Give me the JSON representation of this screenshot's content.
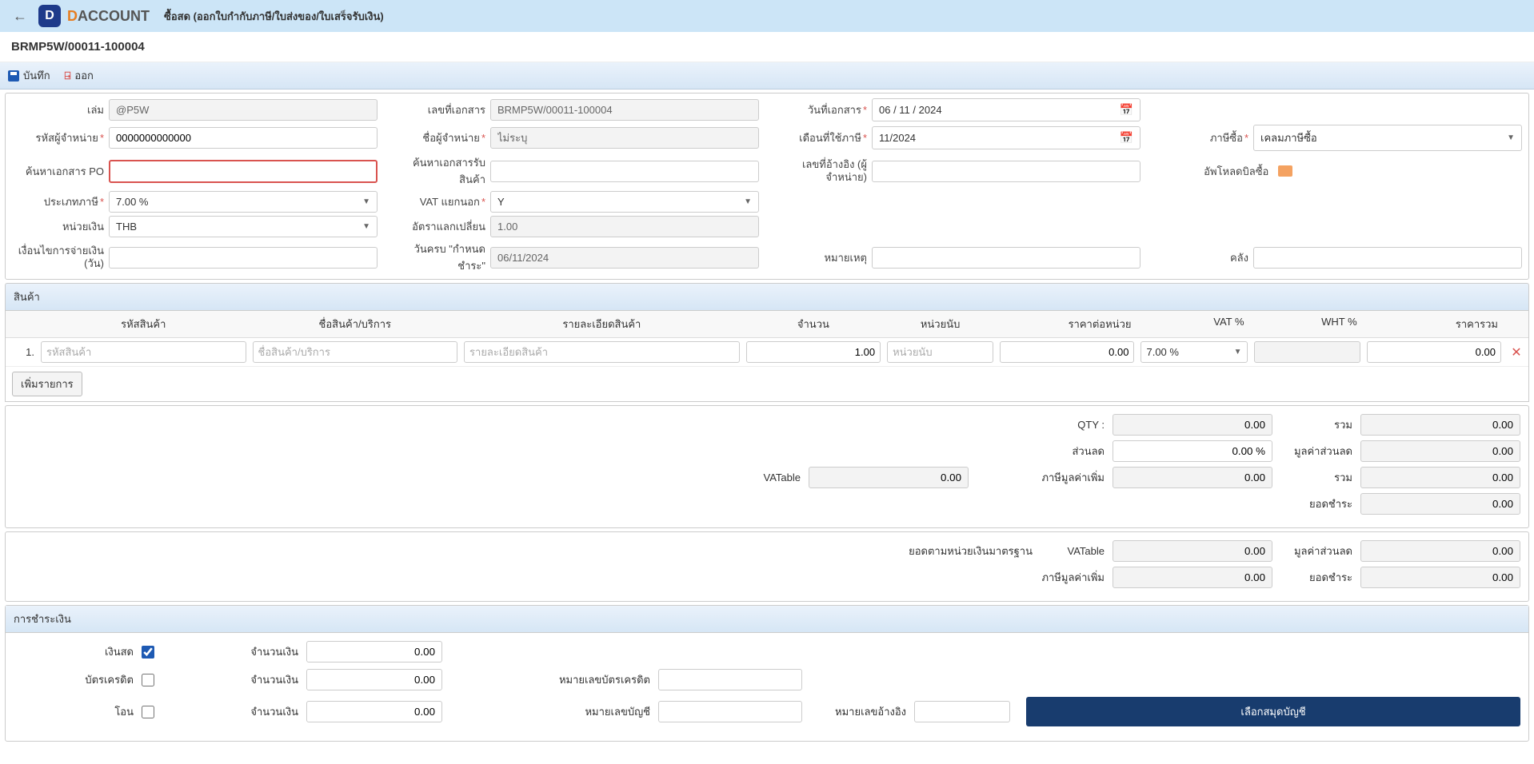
{
  "header": {
    "brand_d": "D",
    "brand_rest": "ACCOUNT",
    "page_title": "ซื้อสด (ออกใบกำกับภาษี/ใบส่งของ/ใบเสร็จรับเงิน)",
    "doc_no": "BRMP5W/00011-100004"
  },
  "toolbar": {
    "save": "บันทึก",
    "exit": "ออก"
  },
  "form": {
    "book_label": "เล่ม",
    "book_value": "@P5W",
    "docno_label": "เลขที่เอกสาร",
    "docno_value": "BRMP5W/00011-100004",
    "docdate_label": "วันที่เอกสาร",
    "docdate_value": "06 / 11 / 2024",
    "vendor_code_label": "รหัสผู้จำหน่าย",
    "vendor_code_value": "0000000000000",
    "vendor_name_label": "ชื่อผู้จำหน่าย",
    "vendor_name_value": "ไม่ระบุ",
    "tax_month_label": "เดือนที่ใช้ภาษี",
    "tax_month_value": "11/2024",
    "purchase_tax_label": "ภาษีซื้อ",
    "purchase_tax_value": "เคลมภาษีซื้อ",
    "search_po_label": "ค้นหาเอกสาร PO",
    "search_gr_label": "ค้นหาเอกสารรับสินค้า",
    "ref_no_label": "เลขที่อ้างอิง (ผู้จำหน่าย)",
    "upload_label": "อัพโหลดบิลซื้อ",
    "vat_type_label": "ประเภทภาษี",
    "vat_type_value": "7.00 %",
    "vat_sep_label": "VAT แยกนอก",
    "vat_sep_value": "Y",
    "currency_label": "หน่วยเงิน",
    "currency_value": "THB",
    "rate_label": "อัตราแลกเปลี่ยน",
    "rate_value": "1.00",
    "terms_label": "เงื่อนไขการจ่ายเงิน (วัน)",
    "due_label": "วันครบ \"กำหนดชำระ\"",
    "due_value": "06/11/2024",
    "remark_label": "หมายเหตุ",
    "warehouse_label": "คลัง"
  },
  "items": {
    "section": "สินค้า",
    "headers": {
      "no": "",
      "code": "รหัสสินค้า",
      "name": "ชื่อสินค้า/บริการ",
      "detail": "รายละเอียดสินค้า",
      "qty": "จำนวน",
      "unit": "หน่วยนับ",
      "price": "ราคาต่อหน่วย",
      "vat": "VAT %",
      "wht": "WHT %",
      "total": "ราคารวม"
    },
    "rows": [
      {
        "no": "1.",
        "code_ph": "รหัสสินค้า",
        "name_ph": "ชื่อสินค้า/บริการ",
        "detail_ph": "รายละเอียดสินค้า",
        "qty": "1.00",
        "unit_ph": "หน่วยนับ",
        "price": "0.00",
        "vat": "7.00 %",
        "total": "0.00"
      }
    ],
    "add": "เพิ่มรายการ"
  },
  "totals1": {
    "qty_label": "QTY :",
    "qty_value": "0.00",
    "sum_label": "รวม",
    "sum_value": "0.00",
    "discount_label": "ส่วนลด",
    "discount_value": "0.00 %",
    "discount_amt_label": "มูลค่าส่วนลด",
    "discount_amt_value": "0.00",
    "vatable_label": "VATable",
    "vatable_value": "0.00",
    "vat_label": "ภาษีมูลค่าเพิ่ม",
    "vat_value": "0.00",
    "sum2_label": "รวม",
    "sum2_value": "0.00",
    "net_label": "ยอดชำระ",
    "net_value": "0.00"
  },
  "totals2": {
    "std_label": "ยอดตามหน่วยเงินมาตรฐาน",
    "vatable_label": "VATable",
    "vatable_value": "0.00",
    "discount_amt_label": "มูลค่าส่วนลด",
    "discount_amt_value": "0.00",
    "vat_label": "ภาษีมูลค่าเพิ่ม",
    "vat_value": "0.00",
    "net_label": "ยอดชำระ",
    "net_value": "0.00"
  },
  "payment": {
    "section": "การชำระเงิน",
    "cash_label": "เงินสด",
    "credit_label": "บัตรเครดิต",
    "transfer_label": "โอน",
    "amount_label": "จำนวนเงิน",
    "amount_value": "0.00",
    "card_ref_label": "หมายเลขบัตรเครดิต",
    "acct_ref_label": "หมายเลขบัญชี",
    "ref_label": "หมายเลขอ้างอิง",
    "select_acct": "เลือกสมุดบัญชี"
  }
}
